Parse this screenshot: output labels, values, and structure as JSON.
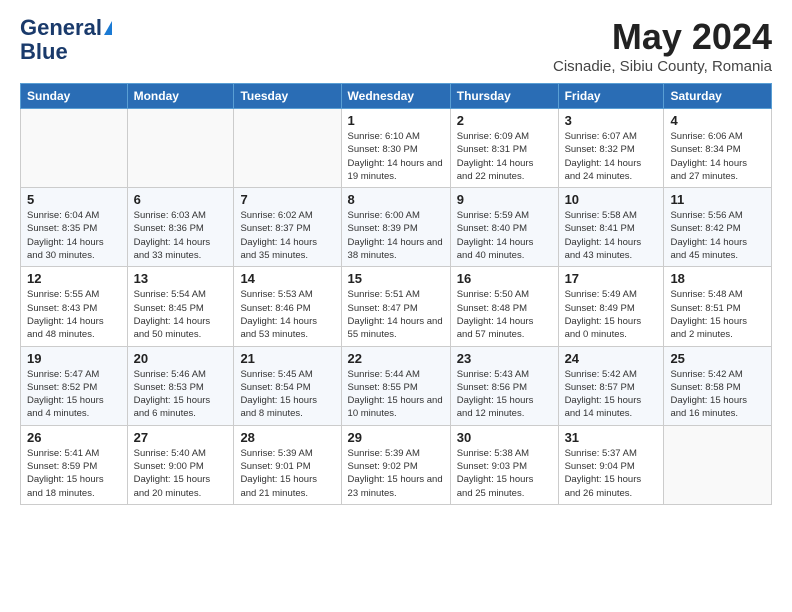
{
  "header": {
    "logo_line1": "General",
    "logo_line2": "Blue",
    "month_title": "May 2024",
    "subtitle": "Cisnadie, Sibiu County, Romania"
  },
  "weekdays": [
    "Sunday",
    "Monday",
    "Tuesday",
    "Wednesday",
    "Thursday",
    "Friday",
    "Saturday"
  ],
  "weeks": [
    [
      {
        "day": "",
        "sunrise": "",
        "sunset": "",
        "daylight": ""
      },
      {
        "day": "",
        "sunrise": "",
        "sunset": "",
        "daylight": ""
      },
      {
        "day": "",
        "sunrise": "",
        "sunset": "",
        "daylight": ""
      },
      {
        "day": "1",
        "sunrise": "Sunrise: 6:10 AM",
        "sunset": "Sunset: 8:30 PM",
        "daylight": "Daylight: 14 hours and 19 minutes."
      },
      {
        "day": "2",
        "sunrise": "Sunrise: 6:09 AM",
        "sunset": "Sunset: 8:31 PM",
        "daylight": "Daylight: 14 hours and 22 minutes."
      },
      {
        "day": "3",
        "sunrise": "Sunrise: 6:07 AM",
        "sunset": "Sunset: 8:32 PM",
        "daylight": "Daylight: 14 hours and 24 minutes."
      },
      {
        "day": "4",
        "sunrise": "Sunrise: 6:06 AM",
        "sunset": "Sunset: 8:34 PM",
        "daylight": "Daylight: 14 hours and 27 minutes."
      }
    ],
    [
      {
        "day": "5",
        "sunrise": "Sunrise: 6:04 AM",
        "sunset": "Sunset: 8:35 PM",
        "daylight": "Daylight: 14 hours and 30 minutes."
      },
      {
        "day": "6",
        "sunrise": "Sunrise: 6:03 AM",
        "sunset": "Sunset: 8:36 PM",
        "daylight": "Daylight: 14 hours and 33 minutes."
      },
      {
        "day": "7",
        "sunrise": "Sunrise: 6:02 AM",
        "sunset": "Sunset: 8:37 PM",
        "daylight": "Daylight: 14 hours and 35 minutes."
      },
      {
        "day": "8",
        "sunrise": "Sunrise: 6:00 AM",
        "sunset": "Sunset: 8:39 PM",
        "daylight": "Daylight: 14 hours and 38 minutes."
      },
      {
        "day": "9",
        "sunrise": "Sunrise: 5:59 AM",
        "sunset": "Sunset: 8:40 PM",
        "daylight": "Daylight: 14 hours and 40 minutes."
      },
      {
        "day": "10",
        "sunrise": "Sunrise: 5:58 AM",
        "sunset": "Sunset: 8:41 PM",
        "daylight": "Daylight: 14 hours and 43 minutes."
      },
      {
        "day": "11",
        "sunrise": "Sunrise: 5:56 AM",
        "sunset": "Sunset: 8:42 PM",
        "daylight": "Daylight: 14 hours and 45 minutes."
      }
    ],
    [
      {
        "day": "12",
        "sunrise": "Sunrise: 5:55 AM",
        "sunset": "Sunset: 8:43 PM",
        "daylight": "Daylight: 14 hours and 48 minutes."
      },
      {
        "day": "13",
        "sunrise": "Sunrise: 5:54 AM",
        "sunset": "Sunset: 8:45 PM",
        "daylight": "Daylight: 14 hours and 50 minutes."
      },
      {
        "day": "14",
        "sunrise": "Sunrise: 5:53 AM",
        "sunset": "Sunset: 8:46 PM",
        "daylight": "Daylight: 14 hours and 53 minutes."
      },
      {
        "day": "15",
        "sunrise": "Sunrise: 5:51 AM",
        "sunset": "Sunset: 8:47 PM",
        "daylight": "Daylight: 14 hours and 55 minutes."
      },
      {
        "day": "16",
        "sunrise": "Sunrise: 5:50 AM",
        "sunset": "Sunset: 8:48 PM",
        "daylight": "Daylight: 14 hours and 57 minutes."
      },
      {
        "day": "17",
        "sunrise": "Sunrise: 5:49 AM",
        "sunset": "Sunset: 8:49 PM",
        "daylight": "Daylight: 15 hours and 0 minutes."
      },
      {
        "day": "18",
        "sunrise": "Sunrise: 5:48 AM",
        "sunset": "Sunset: 8:51 PM",
        "daylight": "Daylight: 15 hours and 2 minutes."
      }
    ],
    [
      {
        "day": "19",
        "sunrise": "Sunrise: 5:47 AM",
        "sunset": "Sunset: 8:52 PM",
        "daylight": "Daylight: 15 hours and 4 minutes."
      },
      {
        "day": "20",
        "sunrise": "Sunrise: 5:46 AM",
        "sunset": "Sunset: 8:53 PM",
        "daylight": "Daylight: 15 hours and 6 minutes."
      },
      {
        "day": "21",
        "sunrise": "Sunrise: 5:45 AM",
        "sunset": "Sunset: 8:54 PM",
        "daylight": "Daylight: 15 hours and 8 minutes."
      },
      {
        "day": "22",
        "sunrise": "Sunrise: 5:44 AM",
        "sunset": "Sunset: 8:55 PM",
        "daylight": "Daylight: 15 hours and 10 minutes."
      },
      {
        "day": "23",
        "sunrise": "Sunrise: 5:43 AM",
        "sunset": "Sunset: 8:56 PM",
        "daylight": "Daylight: 15 hours and 12 minutes."
      },
      {
        "day": "24",
        "sunrise": "Sunrise: 5:42 AM",
        "sunset": "Sunset: 8:57 PM",
        "daylight": "Daylight: 15 hours and 14 minutes."
      },
      {
        "day": "25",
        "sunrise": "Sunrise: 5:42 AM",
        "sunset": "Sunset: 8:58 PM",
        "daylight": "Daylight: 15 hours and 16 minutes."
      }
    ],
    [
      {
        "day": "26",
        "sunrise": "Sunrise: 5:41 AM",
        "sunset": "Sunset: 8:59 PM",
        "daylight": "Daylight: 15 hours and 18 minutes."
      },
      {
        "day": "27",
        "sunrise": "Sunrise: 5:40 AM",
        "sunset": "Sunset: 9:00 PM",
        "daylight": "Daylight: 15 hours and 20 minutes."
      },
      {
        "day": "28",
        "sunrise": "Sunrise: 5:39 AM",
        "sunset": "Sunset: 9:01 PM",
        "daylight": "Daylight: 15 hours and 21 minutes."
      },
      {
        "day": "29",
        "sunrise": "Sunrise: 5:39 AM",
        "sunset": "Sunset: 9:02 PM",
        "daylight": "Daylight: 15 hours and 23 minutes."
      },
      {
        "day": "30",
        "sunrise": "Sunrise: 5:38 AM",
        "sunset": "Sunset: 9:03 PM",
        "daylight": "Daylight: 15 hours and 25 minutes."
      },
      {
        "day": "31",
        "sunrise": "Sunrise: 5:37 AM",
        "sunset": "Sunset: 9:04 PM",
        "daylight": "Daylight: 15 hours and 26 minutes."
      },
      {
        "day": "",
        "sunrise": "",
        "sunset": "",
        "daylight": ""
      }
    ]
  ]
}
